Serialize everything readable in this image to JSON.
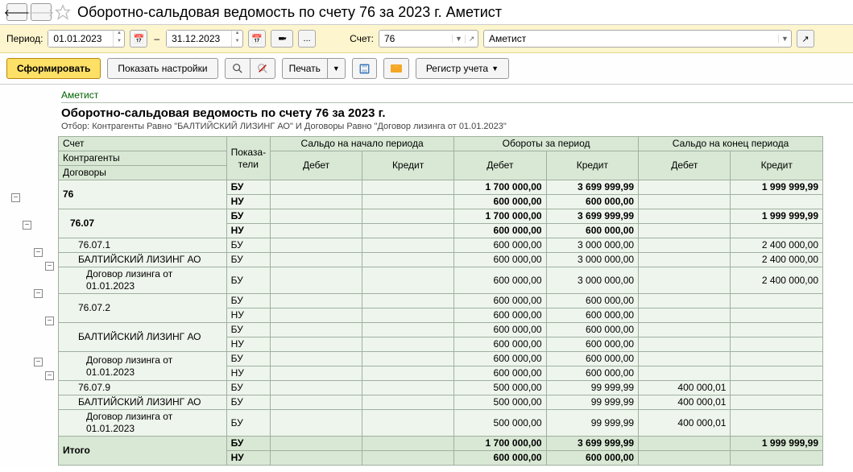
{
  "title": "Оборотно-сальдовая ведомость по счету 76 за 2023 г. Аметист",
  "params": {
    "period_label": "Период:",
    "date_from": "01.01.2023",
    "date_to": "31.12.2023",
    "account_label": "Счет:",
    "account": "76",
    "org": "Аметист",
    "ellipsis": "..."
  },
  "toolbar": {
    "generate": "Сформировать",
    "settings": "Показать настройки",
    "print": "Печать",
    "registry": "Регистр учета"
  },
  "report": {
    "org": "Аметист",
    "title": "Оборотно-сальдовая ведомость по счету 76 за 2023 г.",
    "filter": "Отбор: Контрагенты Равно \"БАЛТИЙСКИЙ ЛИЗИНГ АО\" И Договоры Равно \"Договор лизинга от 01.01.2023\""
  },
  "headers": {
    "account": "Счет",
    "counterparties": "Контрагенты",
    "contracts": "Договоры",
    "indicators": "Показа-\nтели",
    "start_balance": "Сальдо на начало периода",
    "turnover": "Обороты за период",
    "end_balance": "Сальдо на конец периода",
    "debit": "Дебет",
    "credit": "Кредит",
    "total": "Итого"
  },
  "ind": {
    "bu": "БУ",
    "nu": "НУ"
  },
  "rows": [
    {
      "acc": "76",
      "bold": true,
      "indent": 0,
      "bu": {
        "td": "1 700 000,00",
        "tc": "3 699 999,99",
        "ec": "1 999 999,99"
      },
      "nu": {
        "td": "600 000,00",
        "tc": "600 000,00"
      }
    },
    {
      "acc": "76.07",
      "bold": true,
      "indent": 1,
      "bu": {
        "td": "1 700 000,00",
        "tc": "3 699 999,99",
        "ec": "1 999 999,99"
      },
      "nu": {
        "td": "600 000,00",
        "tc": "600 000,00"
      }
    },
    {
      "acc": "76.07.1",
      "bold": false,
      "indent": 2,
      "bu": {
        "td": "600 000,00",
        "tc": "3 000 000,00",
        "ec": "2 400 000,00"
      },
      "single": true
    },
    {
      "acc": "БАЛТИЙСКИЙ ЛИЗИНГ АО",
      "bold": false,
      "indent": 2,
      "bu": {
        "td": "600 000,00",
        "tc": "3 000 000,00",
        "ec": "2 400 000,00"
      },
      "single": true
    },
    {
      "acc": "Договор лизинга от 01.01.2023",
      "bold": false,
      "indent": 3,
      "bu": {
        "td": "600 000,00",
        "tc": "3 000 000,00",
        "ec": "2 400 000,00"
      },
      "single": true
    },
    {
      "acc": "76.07.2",
      "bold": false,
      "indent": 2,
      "bu": {
        "td": "600 000,00",
        "tc": "600 000,00"
      },
      "nu": {
        "td": "600 000,00",
        "tc": "600 000,00"
      }
    },
    {
      "acc": "БАЛТИЙСКИЙ ЛИЗИНГ АО",
      "bold": false,
      "indent": 2,
      "bu": {
        "td": "600 000,00",
        "tc": "600 000,00"
      },
      "nu": {
        "td": "600 000,00",
        "tc": "600 000,00"
      }
    },
    {
      "acc": "Договор лизинга от 01.01.2023",
      "bold": false,
      "indent": 3,
      "bu": {
        "td": "600 000,00",
        "tc": "600 000,00"
      },
      "nu": {
        "td": "600 000,00",
        "tc": "600 000,00"
      }
    },
    {
      "acc": "76.07.9",
      "bold": false,
      "indent": 2,
      "bu": {
        "td": "500 000,00",
        "tc": "99 999,99",
        "ed": "400 000,01"
      },
      "single": true
    },
    {
      "acc": "БАЛТИЙСКИЙ ЛИЗИНГ АО",
      "bold": false,
      "indent": 2,
      "bu": {
        "td": "500 000,00",
        "tc": "99 999,99",
        "ed": "400 000,01"
      },
      "single": true
    },
    {
      "acc": "Договор лизинга от 01.01.2023",
      "bold": false,
      "indent": 3,
      "bu": {
        "td": "500 000,00",
        "tc": "99 999,99",
        "ed": "400 000,01"
      },
      "single": true
    }
  ],
  "total": {
    "bu": {
      "td": "1 700 000,00",
      "tc": "3 699 999,99",
      "ec": "1 999 999,99"
    },
    "nu": {
      "td": "600 000,00",
      "tc": "600 000,00"
    }
  }
}
